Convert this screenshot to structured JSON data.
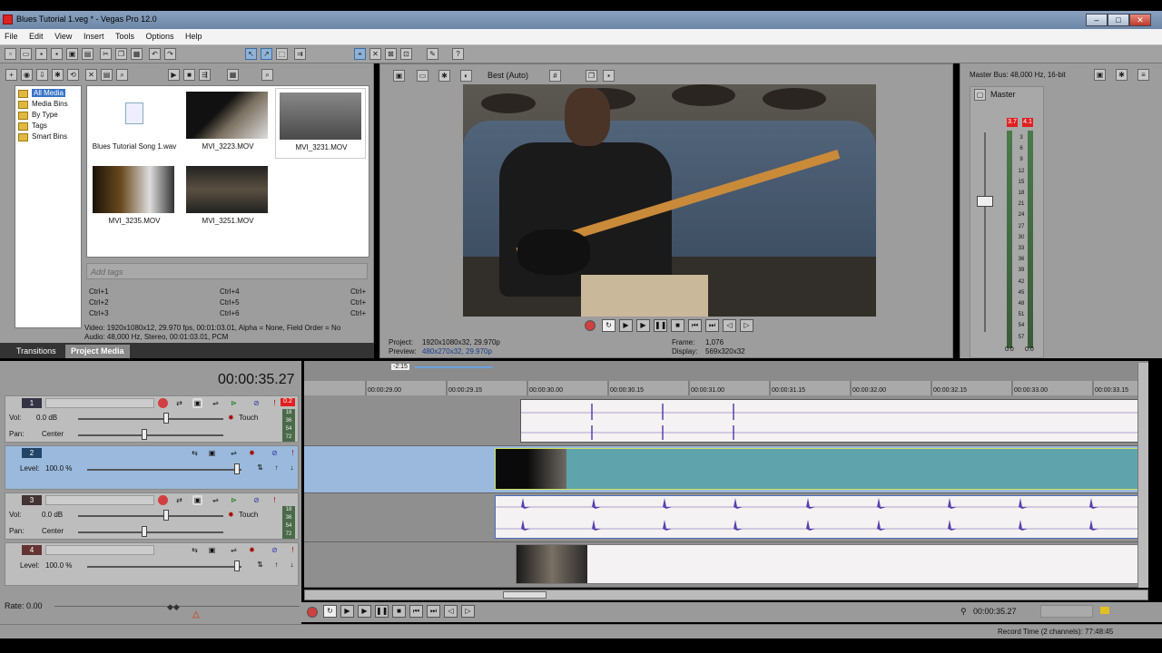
{
  "window": {
    "title": "Blues Tutorial 1.veg * - Vegas Pro 12.0"
  },
  "menu": [
    "File",
    "Edit",
    "View",
    "Insert",
    "Tools",
    "Options",
    "Help"
  ],
  "explorer": {
    "tree": [
      "All Media",
      "Media Bins",
      "By Type",
      "Tags",
      "Smart Bins"
    ],
    "files": [
      {
        "name": "Blues Tutorial Song 1.wav",
        "icon": "audio-file-icon"
      },
      {
        "name": "MVI_3223.MOV",
        "icon": "video-thumbnail"
      },
      {
        "name": "MVI_3231.MOV",
        "icon": "video-thumbnail"
      },
      {
        "name": "MVI_3235.MOV",
        "icon": "video-thumbnail"
      },
      {
        "name": "MVI_3251.MOV",
        "icon": "video-thumbnail"
      }
    ],
    "tags_placeholder": "Add tags",
    "shortcuts": [
      [
        "Ctrl+1",
        "Ctrl+4",
        "Ctrl+"
      ],
      [
        "Ctrl+2",
        "Ctrl+5",
        "Ctrl+"
      ],
      [
        "Ctrl+3",
        "Ctrl+6",
        "Ctrl+"
      ]
    ],
    "info_video": "Video: 1920x1080x12, 29.970 fps, 00:01:03.01, Alpha = None, Field Order = No",
    "info_audio": "Audio: 48,000 Hz, Stereo, 00:01:03.01, PCM",
    "tabs": [
      "Transitions",
      "Project Media"
    ]
  },
  "preview": {
    "quality": "Best (Auto)",
    "project_label": "Project:",
    "project_value": "1920x1080x32, 29.970p",
    "preview_label": "Preview:",
    "preview_value": "480x270x32, 29.970p",
    "frame_label": "Frame:",
    "frame_value": "1,076",
    "display_label": "Display:",
    "display_value": "569x320x32"
  },
  "master": {
    "title": "Master Bus: 48,000 Hz, 16-bit",
    "name": "Master",
    "peak_left": "3.7",
    "peak_right": "4.1",
    "scale": [
      "3",
      "6",
      "9",
      "12",
      "15",
      "18",
      "21",
      "24",
      "27",
      "30",
      "33",
      "36",
      "39",
      "42",
      "45",
      "48",
      "51",
      "54",
      "57"
    ],
    "bottom_left": "0.0",
    "bottom_right": "0.0"
  },
  "timeline": {
    "cursor_time": "00:00:35.27",
    "zoom_badge": "-2:15",
    "ruler": [
      "00:00:29.00",
      "00:00:29.15",
      "00:00:30.00",
      "00:00:30.15",
      "00:00:31.00",
      "00:00:31.15",
      "00:00:32.00",
      "00:00:32.15",
      "00:00:33.00",
      "00:00:33.15"
    ],
    "tracks": [
      {
        "num": "1",
        "type": "audio",
        "vol_label": "Vol:",
        "vol": "0.0 dB",
        "pan_label": "Pan:",
        "pan": "Center",
        "mode": "Touch",
        "meter": [
          "18",
          "36",
          "54",
          "72"
        ],
        "peak": "0.2"
      },
      {
        "num": "2",
        "type": "video",
        "level_label": "Level:",
        "level": "100.0 %"
      },
      {
        "num": "3",
        "type": "audio",
        "vol_label": "Vol:",
        "vol": "0.0 dB",
        "pan_label": "Pan:",
        "pan": "Center",
        "mode": "Touch",
        "meter": [
          "18",
          "36",
          "54",
          "72"
        ]
      },
      {
        "num": "4",
        "type": "video",
        "level_label": "Level:",
        "level": "100.0 %"
      }
    ],
    "rate_label": "Rate: 0.00"
  },
  "status": {
    "end_time": "00:00:35.27",
    "record_time": "Record Time (2 channels): 77:48:45"
  },
  "colors": {
    "selected_track": "#9ab9dc",
    "video_event": "#5fa3ad",
    "audio_wave": "#5a3fb0",
    "peak_red": "#e02020"
  }
}
